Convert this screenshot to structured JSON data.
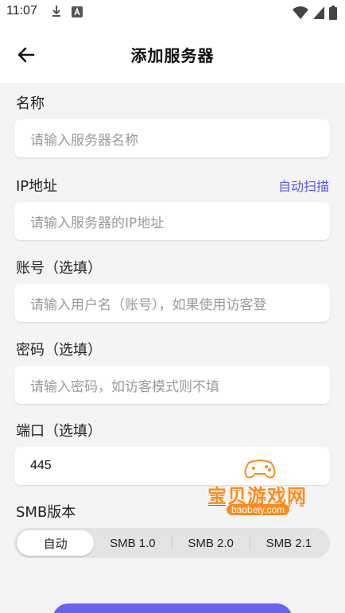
{
  "status_bar": {
    "time": "11:07"
  },
  "header": {
    "title": "添加服务器"
  },
  "form": {
    "name": {
      "label": "名称",
      "placeholder": "请输入服务器名称"
    },
    "ip": {
      "label": "IP地址",
      "link": "自动扫描",
      "placeholder": "请输入服务器的IP地址"
    },
    "account": {
      "label": "账号（选填）",
      "placeholder": "请输入用户名（账号），如果使用访客登"
    },
    "password": {
      "label": "密码（选填）",
      "placeholder": "请输入密码，如访客模式则不填"
    },
    "port": {
      "label": "端口（选填）",
      "value": "445"
    },
    "smb": {
      "label": "SMB版本",
      "options": [
        "自动",
        "SMB 1.0",
        "SMB 2.0",
        "SMB 2.1"
      ],
      "selected": "自动"
    }
  },
  "watermark": {
    "text": "宝贝游戏网",
    "url": "baobeiy.com"
  },
  "colors": {
    "accent": "#5a55e8",
    "button": "#6a63ef",
    "background": "#f4f4f6"
  }
}
